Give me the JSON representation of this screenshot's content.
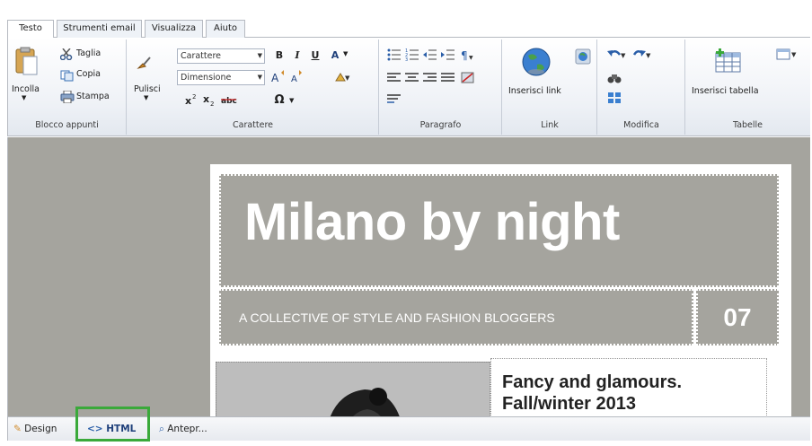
{
  "tabs": [
    "Testo",
    "Strumenti email",
    "Visualizza",
    "Aiuto"
  ],
  "ribbon": {
    "clipboard": {
      "label": "Blocco appunti",
      "paste": "Incolla",
      "cut": "Taglia",
      "copy": "Copia",
      "print": "Stampa"
    },
    "font": {
      "label": "Carattere",
      "clean": "Pulisci",
      "font_combo": "Carattere",
      "size_combo": "Dimensione",
      "bold": "B",
      "italic": "I",
      "underline": "U",
      "font_color": "A",
      "omega": "Ω"
    },
    "paragraph": {
      "label": "Paragrafo"
    },
    "link": {
      "label": "Link",
      "insert_link": "Inserisci link"
    },
    "edit": {
      "label": "Modifica"
    },
    "tables": {
      "label": "Tabelle",
      "insert_table": "Inserisci tabella"
    }
  },
  "document": {
    "title": "Milano by night",
    "subtitle": "A COLLECTIVE OF STYLE AND FASHION BLOGGERS",
    "number": "07",
    "article_title_line1": "Fancy and glamours.",
    "article_title_line2": "Fall/winter 2013"
  },
  "bottom": {
    "design": "Design",
    "html": "HTML",
    "preview": "Antepr..."
  },
  "colors": {
    "accent_highlight": "#3aa93a",
    "editor_bg": "#a5a49e"
  }
}
